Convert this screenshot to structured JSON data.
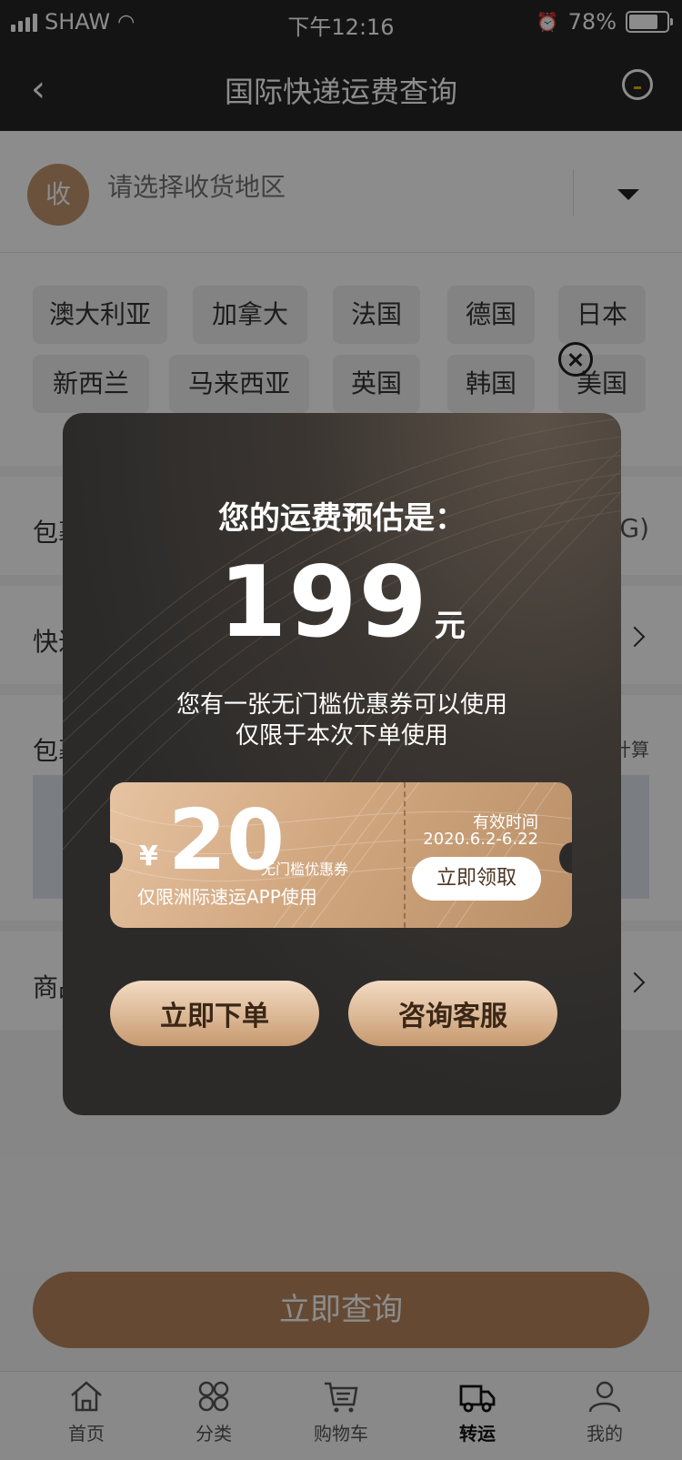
{
  "status": {
    "carrier": "SHAW",
    "time": "下午12:16",
    "battery": "78%",
    "battery_level": 0.78
  },
  "nav": {
    "title": "国际快递运费查询"
  },
  "region": {
    "badge": "收",
    "placeholder": "请选择收货地区"
  },
  "countries": [
    "澳大利亚",
    "加拿大",
    "法国",
    "德国",
    "日本",
    "新西兰",
    "马来西亚",
    "英国",
    "韩国",
    "美国"
  ],
  "rows": {
    "weight_label": "包裹",
    "weight_unit": "(KG)",
    "express_label": "快递",
    "package_label": "包裹",
    "package_hint": "计算",
    "goods_label": "商品"
  },
  "query_button": "立即查询",
  "tabs": [
    {
      "label": "首页",
      "icon": "home-icon"
    },
    {
      "label": "分类",
      "icon": "category-icon"
    },
    {
      "label": "购物车",
      "icon": "cart-icon"
    },
    {
      "label": "转运",
      "icon": "truck-icon"
    },
    {
      "label": "我的",
      "icon": "profile-icon"
    }
  ],
  "modal": {
    "title": "您的运费预估是：",
    "price": "199",
    "unit": "元",
    "desc_line1": "您有一张无门槛优惠券可以使用",
    "desc_line2": "仅限于本次下单使用",
    "coupon": {
      "currency": "¥",
      "amount": "20",
      "type": "无门槛优惠券",
      "note": "仅限洲际速运APP使用",
      "valid_label": "有效时间",
      "valid_date": "2020.6.2-6.22",
      "claim": "立即领取"
    },
    "order_button": "立即下单",
    "service_button": "咨询客服"
  },
  "colors": {
    "accent": "#b9865d",
    "badge": "#c19570",
    "dark": "#262525"
  }
}
